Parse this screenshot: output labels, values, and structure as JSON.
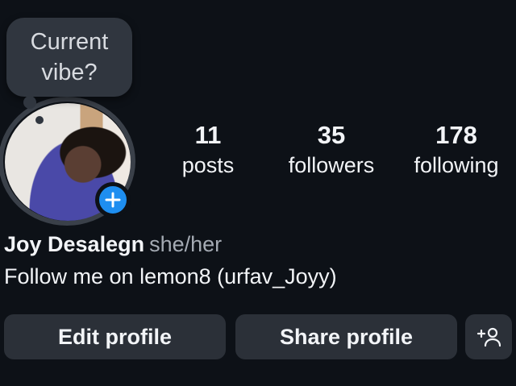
{
  "profile": {
    "note_prompt": "Current vibe?",
    "name": "Joy Desalegn",
    "pronouns": "she/her",
    "bio": "Follow me on lemon8 (urfav_Joyy)"
  },
  "stats": {
    "posts": {
      "value": "11",
      "label": "posts"
    },
    "followers": {
      "value": "35",
      "label": "followers"
    },
    "following": {
      "value": "178",
      "label": "following"
    }
  },
  "actions": {
    "edit_label": "Edit profile",
    "share_label": "Share profile"
  },
  "icons": {
    "add_story": "plus-icon",
    "discover_people": "add-person-icon"
  },
  "colors": {
    "background": "#0d1117",
    "accent": "#1e8ef0",
    "button": "#2b3038"
  }
}
